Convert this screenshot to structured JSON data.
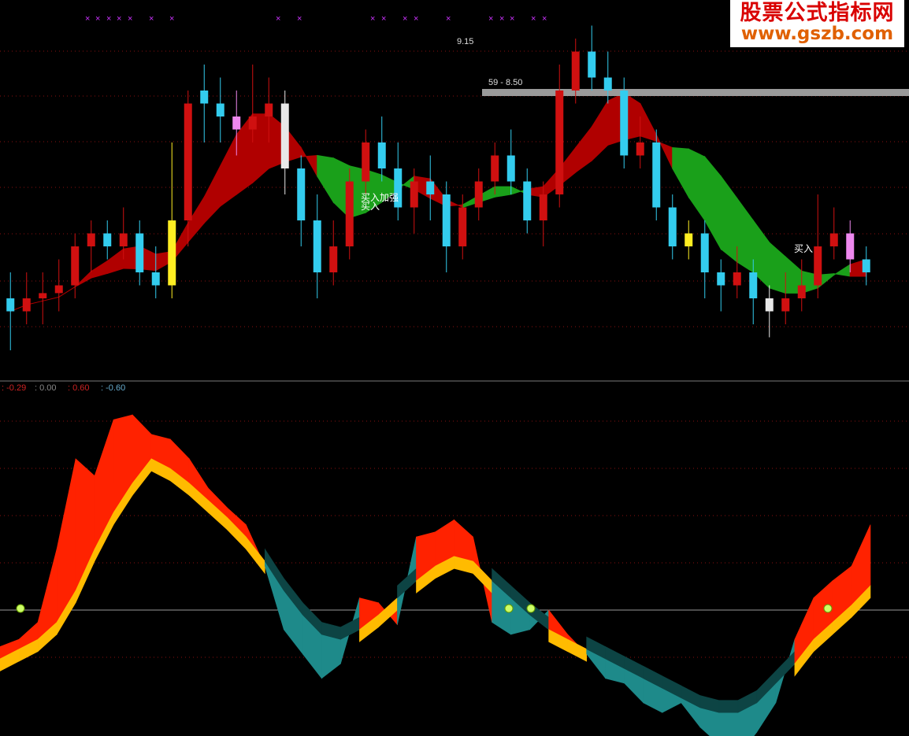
{
  "watermark": {
    "line1": "股票公式指标网",
    "line2": "www.gszb.com"
  },
  "colors": {
    "up": "#d01010",
    "down": "#33ccee",
    "cloud_up": "#b00000",
    "cloud_down": "#1aa01a",
    "pink": "#ee88ee",
    "yellow": "#ffee22",
    "white": "#e8e8e8",
    "osc_red": "#ff2200",
    "osc_orange": "#ffbb00",
    "osc_teal": "#1e8a8a",
    "osc_dark": "#0d4444",
    "grid": "#8a1010",
    "separator": "#7a7a7a"
  },
  "chart_data": [
    {
      "type": "candlestick",
      "annotations": {
        "high_label": "9.15",
        "range_label": "59 - 8.50",
        "signals": [
          "买入加强",
          "买入",
          "买入"
        ]
      },
      "candles": [
        [
          8.1,
          8.05,
          8.2,
          7.9
        ],
        [
          8.05,
          8.1,
          8.2,
          8.0
        ],
        [
          8.1,
          8.12,
          8.2,
          8.0
        ],
        [
          8.12,
          8.15,
          8.25,
          8.05
        ],
        [
          8.15,
          8.3,
          8.35,
          8.1
        ],
        [
          8.3,
          8.35,
          8.4,
          8.2
        ],
        [
          8.35,
          8.3,
          8.4,
          8.25
        ],
        [
          8.3,
          8.35,
          8.45,
          8.25
        ],
        [
          8.35,
          8.2,
          8.4,
          8.15
        ],
        [
          8.2,
          8.15,
          8.3,
          8.1
        ],
        [
          8.15,
          8.4,
          8.7,
          8.1
        ],
        [
          8.4,
          8.85,
          8.9,
          8.3
        ],
        [
          8.9,
          8.85,
          9.0,
          8.7
        ],
        [
          8.85,
          8.8,
          8.95,
          8.7
        ],
        [
          8.8,
          8.75,
          8.9,
          8.65
        ],
        [
          8.75,
          8.8,
          9.0,
          8.7
        ],
        [
          8.8,
          8.85,
          8.95,
          8.7
        ],
        [
          8.85,
          8.6,
          8.9,
          8.5
        ],
        [
          8.6,
          8.4,
          8.65,
          8.3
        ],
        [
          8.4,
          8.2,
          8.5,
          8.1
        ],
        [
          8.2,
          8.3,
          8.4,
          8.15
        ],
        [
          8.3,
          8.55,
          8.6,
          8.25
        ],
        [
          8.55,
          8.7,
          8.75,
          8.5
        ],
        [
          8.7,
          8.6,
          8.8,
          8.55
        ],
        [
          8.6,
          8.45,
          8.7,
          8.4
        ],
        [
          8.45,
          8.55,
          8.6,
          8.35
        ],
        [
          8.55,
          8.5,
          8.65,
          8.4
        ],
        [
          8.5,
          8.3,
          8.55,
          8.2
        ],
        [
          8.3,
          8.45,
          8.5,
          8.25
        ],
        [
          8.45,
          8.55,
          8.6,
          8.4
        ],
        [
          8.55,
          8.65,
          8.7,
          8.5
        ],
        [
          8.65,
          8.55,
          8.75,
          8.5
        ],
        [
          8.55,
          8.4,
          8.6,
          8.35
        ],
        [
          8.4,
          8.5,
          8.55,
          8.3
        ],
        [
          8.5,
          8.9,
          9.0,
          8.45
        ],
        [
          8.9,
          9.05,
          9.1,
          8.85
        ],
        [
          9.05,
          8.95,
          9.15,
          8.9
        ],
        [
          8.95,
          8.9,
          9.05,
          8.85
        ],
        [
          8.9,
          8.65,
          8.95,
          8.6
        ],
        [
          8.65,
          8.7,
          8.8,
          8.6
        ],
        [
          8.7,
          8.45,
          8.75,
          8.4
        ],
        [
          8.45,
          8.3,
          8.5,
          8.25
        ],
        [
          8.3,
          8.35,
          8.4,
          8.25
        ],
        [
          8.35,
          8.2,
          8.4,
          8.1
        ],
        [
          8.2,
          8.15,
          8.25,
          8.05
        ],
        [
          8.15,
          8.2,
          8.3,
          8.1
        ],
        [
          8.2,
          8.1,
          8.25,
          8.0
        ],
        [
          8.1,
          8.05,
          8.15,
          7.95
        ],
        [
          8.05,
          8.1,
          8.2,
          8.0
        ],
        [
          8.1,
          8.15,
          8.25,
          8.05
        ],
        [
          8.15,
          8.3,
          8.5,
          8.1
        ],
        [
          8.3,
          8.35,
          8.45,
          8.25
        ],
        [
          8.35,
          8.25,
          8.4,
          8.2
        ],
        [
          8.25,
          8.2,
          8.3,
          8.15
        ]
      ]
    },
    {
      "type": "area",
      "legend": [
        "-0.29",
        "0.00",
        "0.60",
        "-0.60"
      ],
      "ylim": [
        -0.8,
        0.85
      ],
      "series": [
        {
          "name": "fast",
          "values": [
            -0.15,
            -0.12,
            -0.05,
            0.25,
            0.62,
            0.55,
            0.78,
            0.8,
            0.72,
            0.7,
            0.62,
            0.5,
            0.42,
            0.35,
            0.18,
            -0.08,
            -0.18,
            -0.28,
            -0.22,
            0.05,
            0.03,
            -0.06,
            0.3,
            0.32,
            0.37,
            0.3,
            -0.05,
            -0.1,
            -0.08,
            0.0,
            -0.1,
            -0.18,
            -0.28,
            -0.3,
            -0.38,
            -0.42,
            -0.38,
            -0.48,
            -0.55,
            -0.6,
            -0.5,
            -0.38,
            -0.12,
            0.05,
            0.12,
            0.18,
            0.35
          ]
        },
        {
          "name": "slow",
          "values": [
            -0.2,
            -0.16,
            -0.12,
            -0.05,
            0.08,
            0.25,
            0.4,
            0.52,
            0.62,
            0.58,
            0.52,
            0.45,
            0.38,
            0.3,
            0.2,
            0.08,
            -0.02,
            -0.1,
            -0.12,
            -0.08,
            -0.02,
            0.05,
            0.12,
            0.18,
            0.22,
            0.2,
            0.12,
            0.05,
            -0.02,
            -0.08,
            -0.12,
            -0.16,
            -0.2,
            -0.24,
            -0.28,
            -0.32,
            -0.36,
            -0.4,
            -0.42,
            -0.42,
            -0.38,
            -0.3,
            -0.22,
            -0.12,
            -0.05,
            0.02,
            0.1
          ]
        }
      ]
    }
  ]
}
